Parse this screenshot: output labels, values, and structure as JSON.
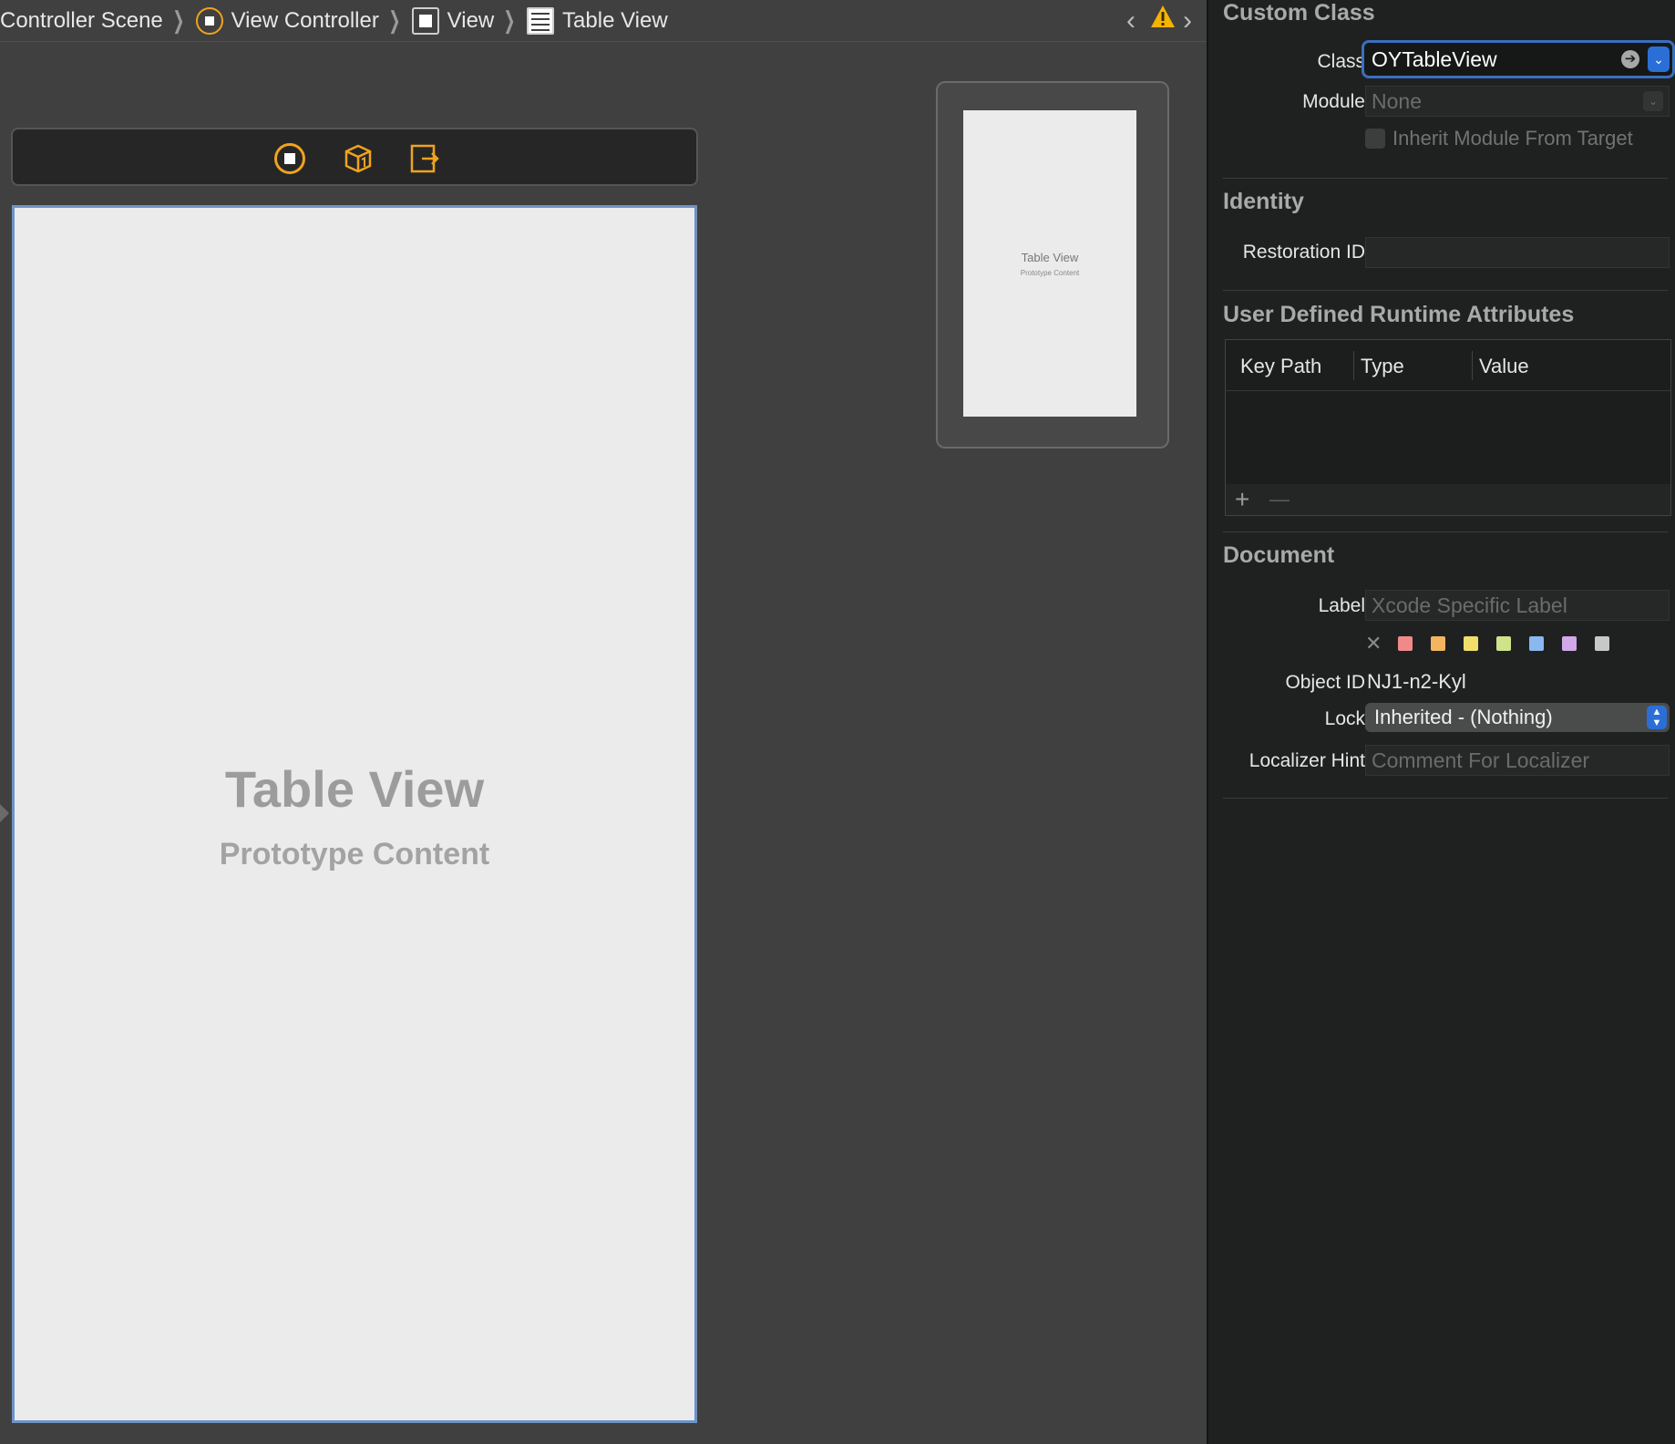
{
  "breadcrumb": {
    "items": [
      "Controller Scene",
      "View Controller",
      "View",
      "Table View"
    ]
  },
  "canvas": {
    "device_title": "Table View",
    "device_subtitle": "Prototype Content"
  },
  "minimap": {
    "title": "Table View",
    "subtitle": "Prototype Content"
  },
  "inspector": {
    "custom_class": {
      "title": "Custom Class",
      "class_label": "Class",
      "class_value": "OYTableView",
      "module_label": "Module",
      "module_placeholder": "None",
      "inherit_label": "Inherit Module From Target"
    },
    "identity": {
      "title": "Identity",
      "restoration_label": "Restoration ID",
      "restoration_value": ""
    },
    "runtime_attributes": {
      "title": "User Defined Runtime Attributes",
      "columns": [
        "Key Path",
        "Type",
        "Value"
      ],
      "add": "+",
      "remove": "—"
    },
    "document": {
      "title": "Document",
      "label_label": "Label",
      "label_placeholder": "Xcode Specific Label",
      "swatch_colors": [
        "#f08a8a",
        "#f2b560",
        "#f2de6a",
        "#cfe38a",
        "#8ab8f0",
        "#d2a8ea",
        "#c8c8c8"
      ],
      "object_id_label": "Object ID",
      "object_id_value": "NJ1-n2-Kyl",
      "lock_label": "Lock",
      "lock_value": "Inherited - (Nothing)",
      "localizer_label": "Localizer Hint",
      "localizer_placeholder": "Comment For Localizer"
    }
  },
  "colors": {
    "accent": "#2b6fd6",
    "warning": "#f5b400",
    "vc_orange": "#f0a31e"
  }
}
